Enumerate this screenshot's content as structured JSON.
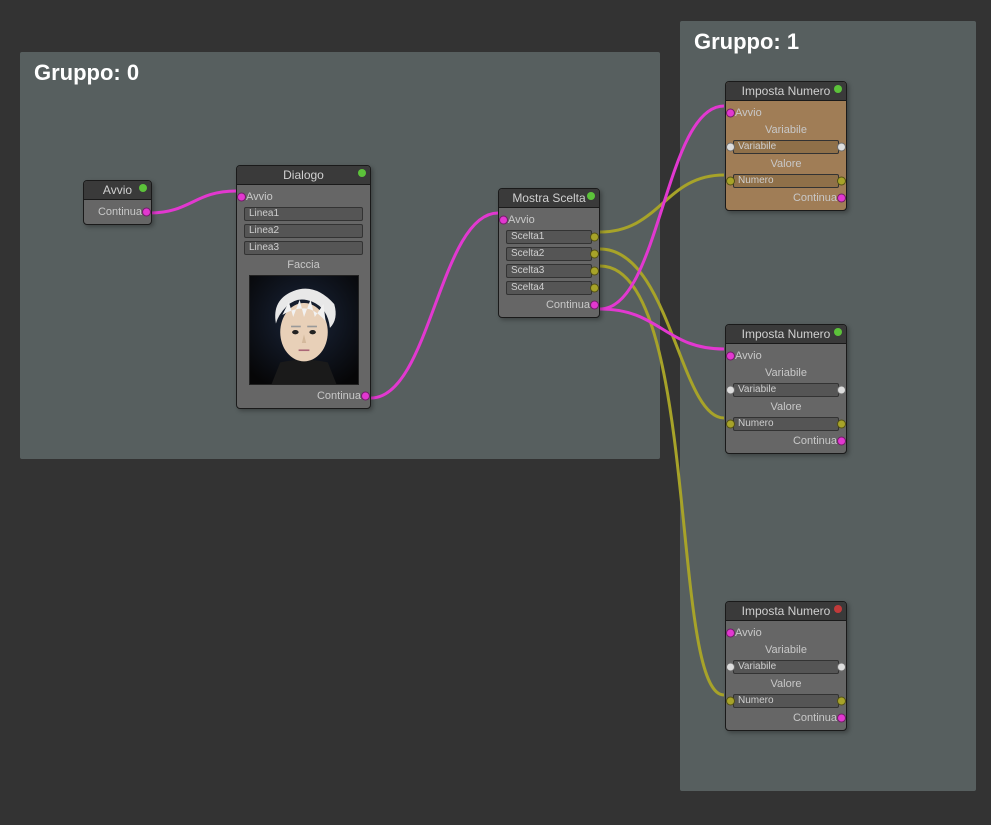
{
  "groups": [
    {
      "title": "Gruppo: 0"
    },
    {
      "title": "Gruppo: 1"
    }
  ],
  "nodes": {
    "avvio": {
      "title": "Avvio",
      "continue": "Continua"
    },
    "dialogo": {
      "title": "Dialogo",
      "avvio": "Avvio",
      "line1": "Linea1",
      "line2": "Linea2",
      "line3": "Linea3",
      "faccia": "Faccia",
      "continue": "Continua"
    },
    "mostrascelta": {
      "title": "Mostra Scelta",
      "avvio": "Avvio",
      "s1": "Scelta1",
      "s2": "Scelta2",
      "s3": "Scelta3",
      "s4": "Scelta4",
      "continue": "Continua"
    },
    "imposta1": {
      "title": "Imposta Numero",
      "avvio": "Avvio",
      "variabileLbl": "Variabile",
      "variabileVal": "Variabile",
      "valoreLbl": "Valore",
      "numeroVal": "Numero",
      "continue": "Continua"
    },
    "imposta2": {
      "title": "Imposta Numero",
      "avvio": "Avvio",
      "variabileLbl": "Variabile",
      "variabileVal": "Variabile",
      "valoreLbl": "Valore",
      "numeroVal": "Numero",
      "continue": "Continua"
    },
    "imposta3": {
      "title": "Imposta Numero",
      "avvio": "Avvio",
      "variabileLbl": "Variabile",
      "variabileVal": "Variabile",
      "valoreLbl": "Valore",
      "numeroVal": "Numero",
      "continue": "Continua"
    }
  }
}
